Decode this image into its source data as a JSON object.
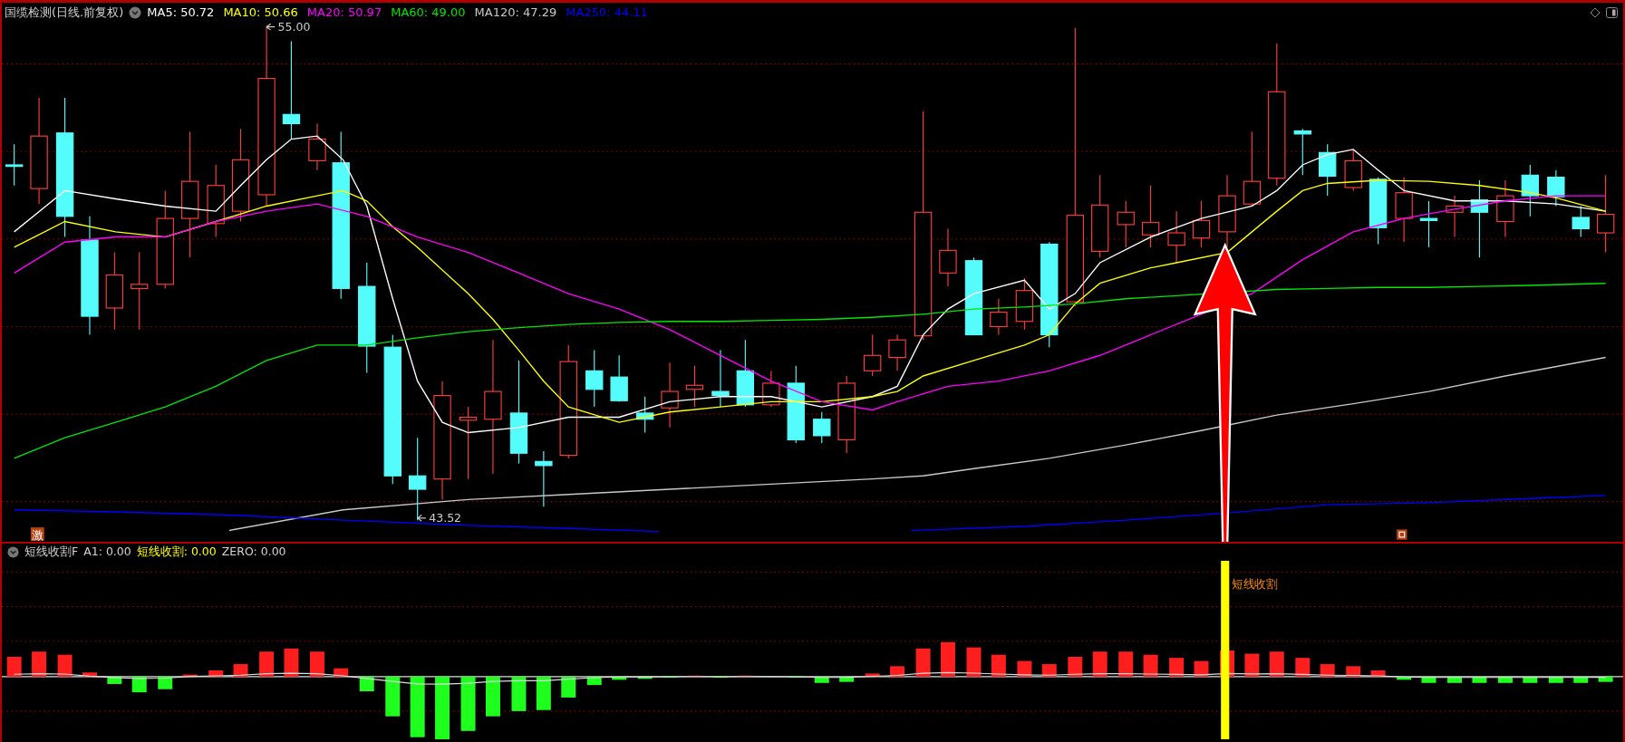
{
  "header": {
    "title": "国缆检测(日线.前复权)",
    "indicators": [
      {
        "label": "MA5: 50.72",
        "color": "#ffffff"
      },
      {
        "label": "MA10: 50.66",
        "color": "#ffff00"
      },
      {
        "label": "MA20: 50.97",
        "color": "#ff00ff"
      },
      {
        "label": "MA60: 49.00",
        "color": "#00e600"
      },
      {
        "label": "MA120: 47.29",
        "color": "#c8c8c8"
      },
      {
        "label": "MA250: 44.11",
        "color": "#0000ff"
      }
    ]
  },
  "price_labels": [
    {
      "kind": "high",
      "text": "55.00"
    },
    {
      "kind": "low",
      "text": "43.52"
    }
  ],
  "signal_badge": "激",
  "sub": {
    "title": "短线收割F",
    "values": [
      {
        "label": "A1: 0.00",
        "color": "#d2d2d2"
      },
      {
        "label": "短线收割: 0.00",
        "color": "#ffff00"
      },
      {
        "label": "ZERO: 0.00",
        "color": "#d2d2d2"
      }
    ],
    "signal_label": "短线收割"
  }
}
